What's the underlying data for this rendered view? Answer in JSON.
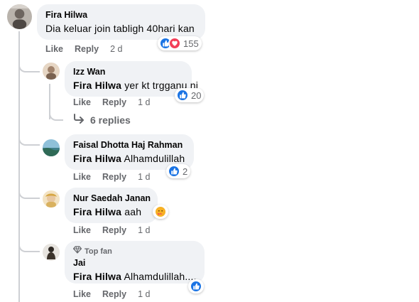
{
  "actions": {
    "like": "Like",
    "reply": "Reply"
  },
  "comments": [
    {
      "author": "Fira Hilwa",
      "mention": "",
      "text": "Dia keluar join tabligh 40hari kan",
      "time": "2 d",
      "reaction_count": "155",
      "reaction_icons": [
        "like-icon",
        "love-icon"
      ]
    },
    {
      "author": "Izz Wan",
      "mention": "Fira Hilwa",
      "text": "yer kt trgganu ni",
      "time": "1 d",
      "reaction_count": "20",
      "reaction_icons": [
        "like-icon"
      ]
    },
    {
      "author": "Faisal Dhotta Haj Rahman",
      "mention": "Fira Hilwa",
      "text": "Alhamdulillah",
      "time": "1 d",
      "reaction_count": "2",
      "reaction_icons": [
        "like-icon"
      ]
    },
    {
      "author": "Nur Saedah Janan",
      "mention": "Fira Hilwa",
      "text": "aah",
      "time": "1 d",
      "reaction_count": "",
      "reaction_icons": [
        "care-icon"
      ]
    },
    {
      "author": "Jai",
      "badge": "Top fan",
      "mention": "Fira Hilwa",
      "text": "Alhamdulillah....",
      "time": "1 d",
      "reaction_count": "",
      "reaction_icons": [
        "like-icon"
      ]
    }
  ],
  "view_replies": {
    "label": "6 replies",
    "icon": "reply-arrow-icon"
  },
  "colors": {
    "like_blue": "#1b74e4",
    "love_red": "#f33e58",
    "care_yellow": "#f7b125",
    "bubble_bg": "#f0f2f5",
    "muted_text": "#65676b"
  }
}
